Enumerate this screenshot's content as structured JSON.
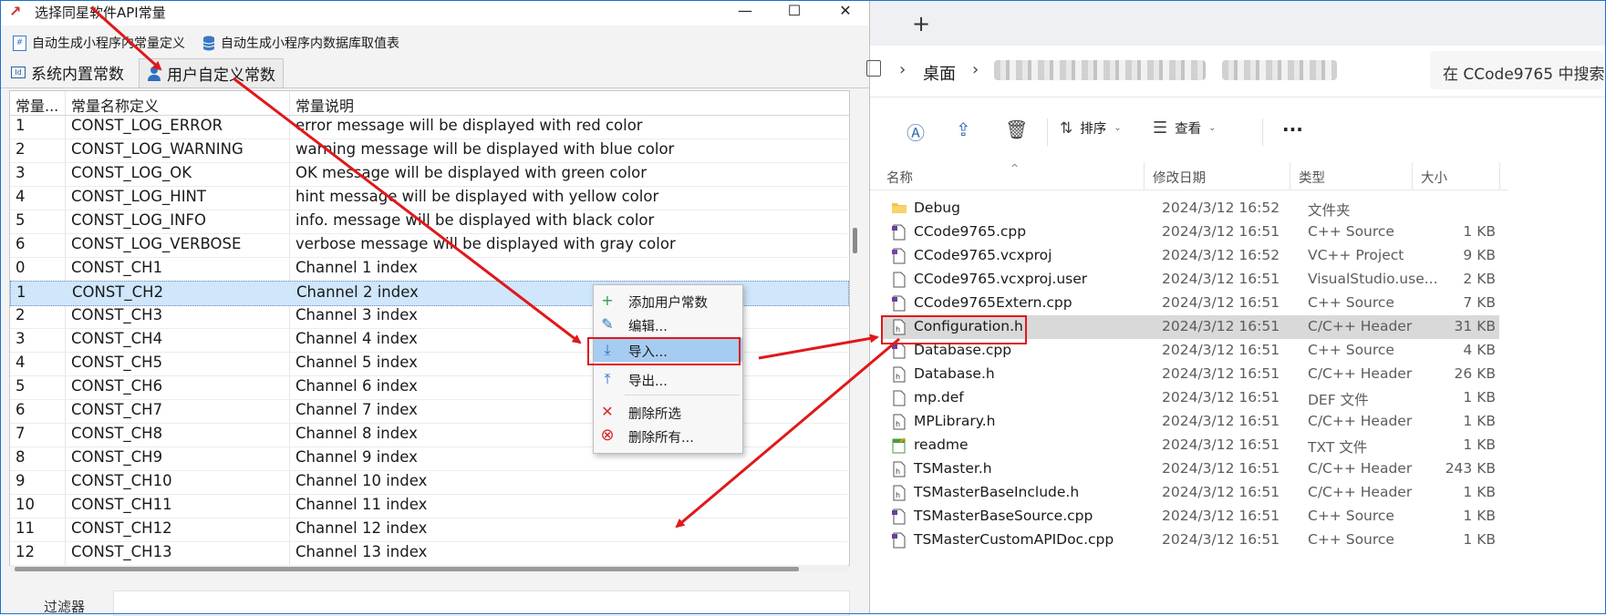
{
  "dialog": {
    "title": "选择同星软件API常量",
    "window_buttons": [
      "—",
      "☐",
      "✕"
    ],
    "toolbar": {
      "item1": "自动生成小程序内常量定义",
      "item2": "自动生成小程序内数据库取值表"
    },
    "tabs": [
      "系统内置常数",
      "用户自定义常数"
    ],
    "active_tab": 1,
    "grid": {
      "headers": [
        "常量...",
        "常量名称定义",
        "常量说明"
      ],
      "rows": [
        [
          "1",
          "CONST_LOG_ERROR",
          "error message will be displayed with red color"
        ],
        [
          "2",
          "CONST_LOG_WARNING",
          "warning message will be displayed with blue color"
        ],
        [
          "3",
          "CONST_LOG_OK",
          "OK message will be displayed with green color"
        ],
        [
          "4",
          "CONST_LOG_HINT",
          "hint message will be displayed with yellow color"
        ],
        [
          "5",
          "CONST_LOG_INFO",
          "info. message will be displayed with black color"
        ],
        [
          "6",
          "CONST_LOG_VERBOSE",
          "verbose message will be displayed with gray color"
        ],
        [
          "0",
          "CONST_CH1",
          "Channel 1 index"
        ],
        [
          "1",
          "CONST_CH2",
          "Channel 2 index"
        ],
        [
          "2",
          "CONST_CH3",
          "Channel 3 index"
        ],
        [
          "3",
          "CONST_CH4",
          "Channel 4 index"
        ],
        [
          "4",
          "CONST_CH5",
          "Channel 5 index"
        ],
        [
          "5",
          "CONST_CH6",
          "Channel 6 index"
        ],
        [
          "6",
          "CONST_CH7",
          "Channel 7 index"
        ],
        [
          "7",
          "CONST_CH8",
          "Channel 8 index"
        ],
        [
          "8",
          "CONST_CH9",
          "Channel 9 index"
        ],
        [
          "9",
          "CONST_CH10",
          "Channel 10 index"
        ],
        [
          "10",
          "CONST_CH11",
          "Channel 11 index"
        ],
        [
          "11",
          "CONST_CH12",
          "Channel 12 index"
        ],
        [
          "12",
          "CONST_CH13",
          "Channel 13 index"
        ]
      ],
      "selected_row": 7
    },
    "filter_label": "过滤器"
  },
  "context_menu": {
    "items": [
      {
        "label": "添加用户常数",
        "icon": "plus-icon",
        "color": "#2e9e4f"
      },
      {
        "label": "编辑...",
        "icon": "pencil-icon",
        "color": "#2f6fc0"
      },
      {
        "label": "导入...",
        "icon": "import-icon",
        "color": "#2f6fc0"
      },
      {
        "label": "导出...",
        "icon": "export-icon",
        "color": "#2f6fc0"
      },
      {
        "label": "删除所选",
        "icon": "x-icon",
        "color": "#d9262a"
      },
      {
        "label": "删除所有...",
        "icon": "x-circle-icon",
        "color": "#d9262a"
      }
    ],
    "highlighted": 2
  },
  "explorer": {
    "new_tab": "+",
    "breadcrumb": "桌面",
    "search_placeholder": "在 CCode9765 中搜索",
    "commands": {
      "sort": "排序",
      "view": "查看",
      "more": "···"
    },
    "columns": [
      "名称",
      "修改日期",
      "类型",
      "大小"
    ],
    "files": [
      {
        "name": "Debug",
        "date": "2024/3/12 16:52",
        "type": "文件夹",
        "size": "",
        "icon": "folder-icon"
      },
      {
        "name": "CCode9765.cpp",
        "date": "2024/3/12 16:51",
        "type": "C++ Source",
        "size": "1 KB",
        "icon": "cpp-file-icon"
      },
      {
        "name": "CCode9765.vcxproj",
        "date": "2024/3/12 16:52",
        "type": "VC++ Project",
        "size": "9 KB",
        "icon": "project-file-icon"
      },
      {
        "name": "CCode9765.vcxproj.user",
        "date": "2024/3/12 16:51",
        "type": "VisualStudio.use...",
        "size": "2 KB",
        "icon": "blank-file-icon"
      },
      {
        "name": "CCode9765Extern.cpp",
        "date": "2024/3/12 16:51",
        "type": "C++ Source",
        "size": "7 KB",
        "icon": "cpp-file-icon"
      },
      {
        "name": "Configuration.h",
        "date": "2024/3/12 16:51",
        "type": "C/C++ Header",
        "size": "31 KB",
        "icon": "header-file-icon"
      },
      {
        "name": "Database.cpp",
        "date": "2024/3/12 16:51",
        "type": "C++ Source",
        "size": "4 KB",
        "icon": "cpp-file-icon"
      },
      {
        "name": "Database.h",
        "date": "2024/3/12 16:51",
        "type": "C/C++ Header",
        "size": "26 KB",
        "icon": "header-file-icon"
      },
      {
        "name": "mp.def",
        "date": "2024/3/12 16:51",
        "type": "DEF 文件",
        "size": "1 KB",
        "icon": "blank-file-icon"
      },
      {
        "name": "MPLibrary.h",
        "date": "2024/3/12 16:51",
        "type": "C/C++ Header",
        "size": "1 KB",
        "icon": "header-file-icon"
      },
      {
        "name": "readme",
        "date": "2024/3/12 16:51",
        "type": "TXT 文件",
        "size": "1 KB",
        "icon": "text-file-icon"
      },
      {
        "name": "TSMaster.h",
        "date": "2024/3/12 16:51",
        "type": "C/C++ Header",
        "size": "243 KB",
        "icon": "header-file-icon"
      },
      {
        "name": "TSMasterBaseInclude.h",
        "date": "2024/3/12 16:51",
        "type": "C/C++ Header",
        "size": "1 KB",
        "icon": "header-file-icon"
      },
      {
        "name": "TSMasterBaseSource.cpp",
        "date": "2024/3/12 16:51",
        "type": "C++ Source",
        "size": "1 KB",
        "icon": "cpp-file-icon"
      },
      {
        "name": "TSMasterCustomAPIDoc.cpp",
        "date": "2024/3/12 16:51",
        "type": "C++ Source",
        "size": "1 KB",
        "icon": "cpp-file-icon"
      }
    ],
    "selected_file": 5
  },
  "annotation_color": "#e0181b"
}
